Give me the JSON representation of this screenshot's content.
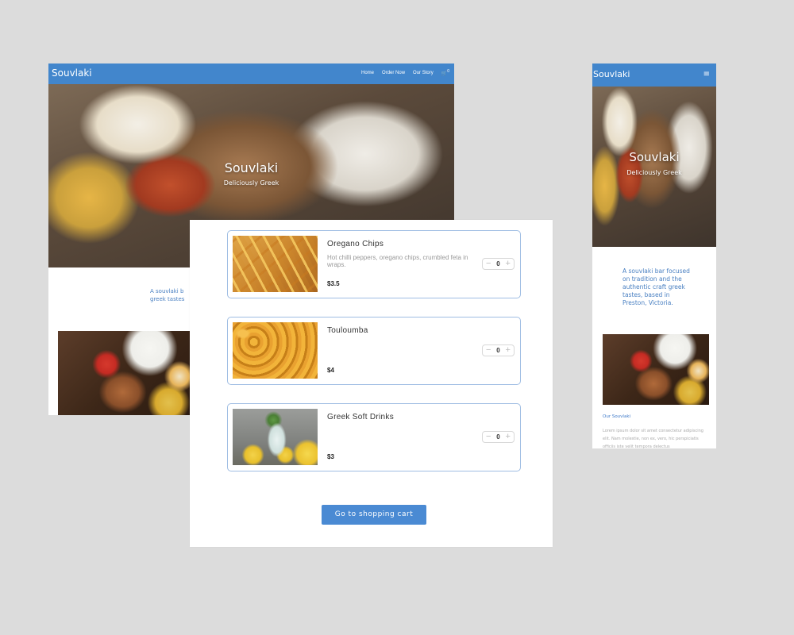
{
  "desktop": {
    "brand": "Souvlaki",
    "nav": [
      "Home",
      "Order Now",
      "Our Story"
    ],
    "cart_count": "0",
    "hero_title": "Souvlaki",
    "hero_subtitle": "Deliciously Greek",
    "intro_lines": [
      "A souvlaki b",
      "greek tastes"
    ]
  },
  "menu": {
    "items": [
      {
        "name": "Oregano Chips",
        "description": "Hot chilli peppers, oregano chips, crumbled feta in wraps.",
        "price": "$3.5",
        "qty": "0"
      },
      {
        "name": "Touloumba",
        "description": "",
        "price": "$4",
        "qty": "0"
      },
      {
        "name": "Greek Soft Drinks",
        "description": "",
        "price": "$3",
        "qty": "0"
      }
    ],
    "stepper": {
      "minus": "−",
      "plus": "+"
    },
    "cart_button": "Go to shopping cart"
  },
  "mobile": {
    "brand": "Souvlaki",
    "menu_icon": "≡",
    "hero_title": "Souvlaki",
    "hero_subtitle": "Deliciously Greek",
    "intro": "A souvlaki bar focused on tradition and the authentic craft greek tastes, based in Preston, Victoria.",
    "story_heading": "Our Souvlaki",
    "story_text": "Lorem ipsum dolor sit amet consectetur adipiscing elit. Nam molestie, non ex, vero, hic perspiciatis officiis iste velit tempora delectus"
  },
  "colors": {
    "brand_blue": "#4286cc",
    "accent_blue": "#4a8ad3",
    "card_border": "#9fbde3",
    "backdrop": "#dcdcdc"
  },
  "icons": {
    "cart": "cart-icon",
    "menu": "hamburger-menu-icon",
    "minus": "minus-icon",
    "plus": "plus-icon"
  }
}
